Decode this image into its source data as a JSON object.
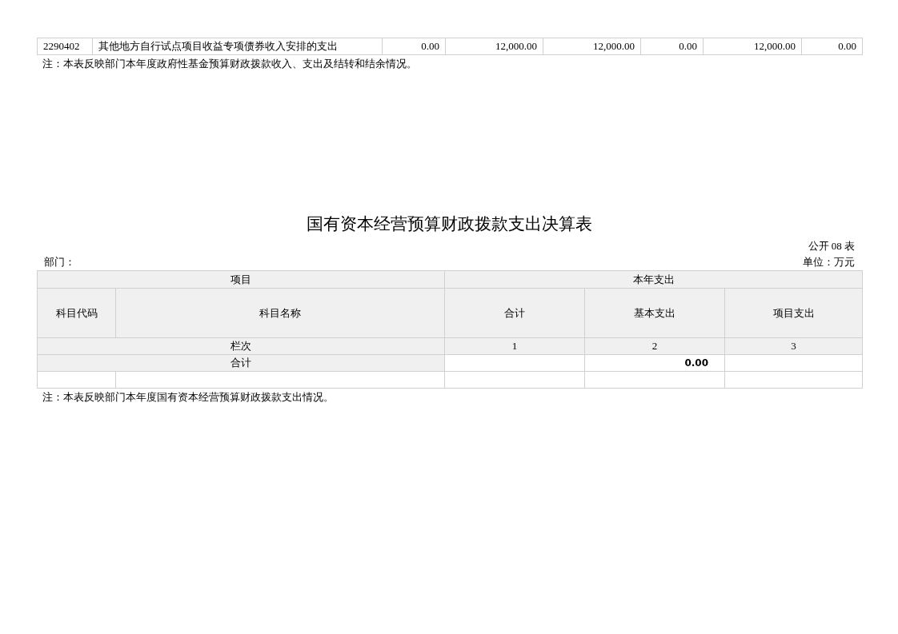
{
  "previous_table": {
    "rows": [
      {
        "code": "2290402",
        "name": "其他地方自行试点项目收益专项债券收入安排的支出",
        "values": [
          "0.00",
          "12,000.00",
          "12,000.00",
          "0.00",
          "12,000.00",
          "0.00"
        ]
      }
    ]
  },
  "previous_note": "注：本表反映部门本年度政府性基金预算财政拨款收入、支出及结转和结余情况。",
  "title": "国有资本经营预算财政拨款支出决算表",
  "form_number": "公开 08 表",
  "department_label": "部门：",
  "unit_label": "单位：万元",
  "table": {
    "group_headers": [
      "项目",
      "本年支出"
    ],
    "columns": [
      "科目代码",
      "科目名称",
      "合计",
      "基本支出",
      "项目支出"
    ],
    "index_row": {
      "label": "栏次",
      "values": [
        "1",
        "2",
        "3"
      ]
    },
    "total_row": {
      "label": "合计",
      "basic_expense": "0.00"
    }
  },
  "note": "注：本表反映部门本年度国有资本经营预算财政拨款支出情况。"
}
